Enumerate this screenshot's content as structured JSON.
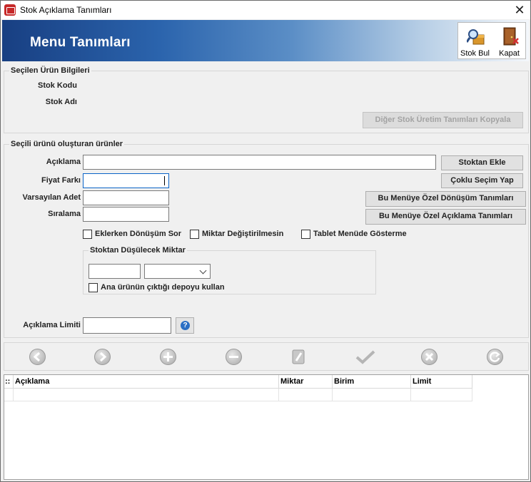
{
  "window": {
    "title": "Stok Açıklama Tanımları",
    "close_glyph": "✕"
  },
  "header": {
    "title": "Menu Tanımları"
  },
  "toolbar": {
    "stok_bul": "Stok Bul",
    "kapat": "Kapat"
  },
  "secilen": {
    "title": "Seçilen Ürün Bilgileri",
    "stok_kodu": "Stok Kodu",
    "stok_adi": "Stok Adı",
    "copy_button": "Diğer Stok Üretim Tanımları Kopyala"
  },
  "olusturan": {
    "title": "Seçili ürünü oluşturan ürünler",
    "aciklama": "Açıklama",
    "fiyat_farki": "Fiyat Farkı",
    "varsayilan_adet": "Varsayılan Adet",
    "siralama": "Sıralama",
    "stoktan_ekle": "Stoktan Ekle",
    "coklu_secim": "Çoklu Seçim Yap",
    "donusum_tanimlari": "Bu Menüye Özel Dönüşüm Tanımları",
    "aciklama_tanimlari": "Bu Menüye Özel Açıklama Tanımları",
    "chk_eklerken": "Eklerken Dönüşüm Sor",
    "chk_miktar": "Miktar Değiştirilmesin",
    "chk_tablet": "Tablet Menüde Gösterme",
    "dusulecek_title": "Stoktan Düşülecek Miktar",
    "chk_depo": "Ana ürünün çıktığı depoyu kullan",
    "aciklama_limiti": "Açıklama Limiti",
    "help_glyph": "?"
  },
  "grid": {
    "columns": [
      "Açıklama",
      "Miktar",
      "Birim",
      "Limit"
    ],
    "row_indicator": "::"
  }
}
